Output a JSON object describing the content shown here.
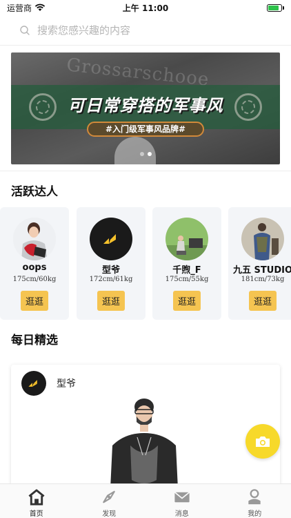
{
  "status_bar": {
    "carrier": "运营商",
    "time": "上午 11:00",
    "battery_level": 0.85
  },
  "search": {
    "placeholder": "搜索您感兴趣的内容"
  },
  "banner": {
    "background_text": "Grossarschooe",
    "title": "可日常穿搭的军事风",
    "tag": "#入门级军事风品牌#",
    "slide_count": 2,
    "active_slide": 1
  },
  "sections": {
    "active_creators": "活跃达人",
    "daily_picks": "每日精选"
  },
  "creators": [
    {
      "name": "oops",
      "stats": "175cm/60kg",
      "button": "逛逛",
      "avatar": "person-avatar"
    },
    {
      "name": "型爷",
      "stats": "172cm/61kg",
      "button": "逛逛",
      "avatar": "brand-logo-avatar"
    },
    {
      "name": "千煦_F",
      "stats": "175cm/55kg",
      "button": "逛逛",
      "avatar": "person-avatar"
    },
    {
      "name": "九五 STUDIO",
      "stats": "181cm/73kg",
      "button": "逛逛",
      "avatar": "person-avatar"
    }
  ],
  "daily_card": {
    "author": "型爷"
  },
  "tabs": [
    {
      "label": "首页",
      "icon": "home-icon",
      "active": true
    },
    {
      "label": "发现",
      "icon": "compass-icon",
      "active": false
    },
    {
      "label": "消息",
      "icon": "mail-icon",
      "active": false
    },
    {
      "label": "我的",
      "icon": "profile-icon",
      "active": false
    }
  ],
  "colors": {
    "accent_yellow": "#f5c451",
    "fab_yellow": "#f7d92a",
    "banner_green": "#265c3e",
    "card_bg": "#f3f5f8"
  }
}
